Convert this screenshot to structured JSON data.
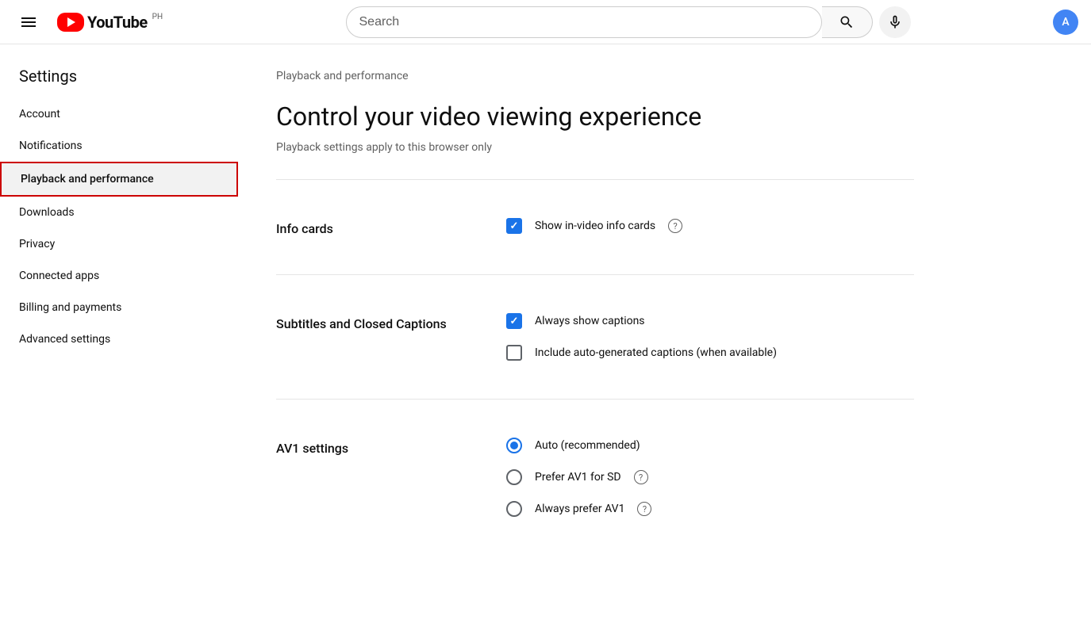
{
  "header": {
    "hamburger_label": "Menu",
    "logo_text": "YouTube",
    "country_badge": "PH",
    "search_placeholder": "Search",
    "search_btn_label": "Search",
    "mic_btn_label": "Search with your voice"
  },
  "sidebar": {
    "title": "Settings",
    "items": [
      {
        "id": "account",
        "label": "Account",
        "active": false
      },
      {
        "id": "notifications",
        "label": "Notifications",
        "active": false
      },
      {
        "id": "playback",
        "label": "Playback and performance",
        "active": true
      },
      {
        "id": "downloads",
        "label": "Downloads",
        "active": false
      },
      {
        "id": "privacy",
        "label": "Privacy",
        "active": false
      },
      {
        "id": "connected-apps",
        "label": "Connected apps",
        "active": false
      },
      {
        "id": "billing",
        "label": "Billing and payments",
        "active": false
      },
      {
        "id": "advanced",
        "label": "Advanced settings",
        "active": false
      }
    ]
  },
  "main": {
    "breadcrumb": "Playback and performance",
    "heading": "Control your video viewing experience",
    "subheading": "Playback settings apply to this browser only",
    "sections": [
      {
        "id": "info-cards",
        "label": "Info cards",
        "controls": [
          {
            "type": "checkbox",
            "checked": true,
            "label": "Show in-video info cards",
            "has_help": true
          }
        ]
      },
      {
        "id": "subtitles",
        "label": "Subtitles and Closed Captions",
        "controls": [
          {
            "type": "checkbox",
            "checked": true,
            "label": "Always show captions",
            "has_help": false
          },
          {
            "type": "checkbox",
            "checked": false,
            "label": "Include auto-generated captions (when available)",
            "has_help": false
          }
        ]
      },
      {
        "id": "av1",
        "label": "AV1 settings",
        "controls": [
          {
            "type": "radio",
            "selected": true,
            "label": "Auto (recommended)",
            "has_help": false
          },
          {
            "type": "radio",
            "selected": false,
            "label": "Prefer AV1 for SD",
            "has_help": true
          },
          {
            "type": "radio",
            "selected": false,
            "label": "Always prefer AV1",
            "has_help": true
          }
        ]
      }
    ]
  }
}
